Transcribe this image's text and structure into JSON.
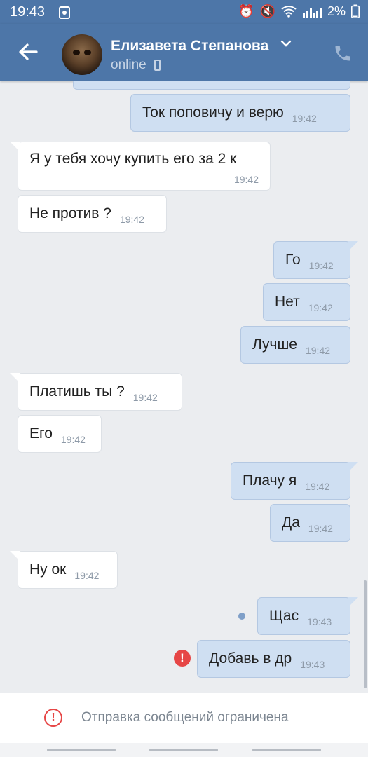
{
  "status_bar": {
    "time": "19:43",
    "battery": "2%",
    "icons": [
      "notification-icon",
      "alarm-icon",
      "mute-icon",
      "wifi-icon",
      "signal-icon",
      "battery-icon"
    ]
  },
  "header": {
    "contact_name": "Елизавета Степанова",
    "status": "online",
    "icons": [
      "back-arrow-icon",
      "avatar",
      "chevron-down-icon",
      "mobile-icon",
      "phone-icon"
    ]
  },
  "messages": [
    {
      "direction": "out",
      "text": "Ток поповичу и верю",
      "time": "19:42"
    },
    {
      "direction": "in",
      "text": "Я у тебя хочу купить его за 2 к",
      "time": "19:42"
    },
    {
      "direction": "in",
      "text": "Не против ?",
      "time": "19:42"
    },
    {
      "direction": "out",
      "text": "Го",
      "time": "19:42"
    },
    {
      "direction": "out",
      "text": "Нет",
      "time": "19:42"
    },
    {
      "direction": "out",
      "text": "Лучше",
      "time": "19:42"
    },
    {
      "direction": "in",
      "text": "Платишь ты ?",
      "time": "19:42"
    },
    {
      "direction": "in",
      "text": "Его",
      "time": "19:42"
    },
    {
      "direction": "out",
      "text": "Плачу я",
      "time": "19:42"
    },
    {
      "direction": "out",
      "text": "Да",
      "time": "19:42"
    },
    {
      "direction": "in",
      "text": "Ну ок",
      "time": "19:42"
    },
    {
      "direction": "out",
      "text": "Щас",
      "time": "19:43",
      "state": "sending"
    },
    {
      "direction": "out",
      "text": "Добавь в др",
      "time": "19:43",
      "state": "error"
    }
  ],
  "footer": {
    "restriction_text": "Отправка сообщений ограничена"
  },
  "colors": {
    "header": "#4d76a8",
    "outgoing_bubble": "#cfdff2",
    "incoming_bubble": "#ffffff",
    "background": "#ebedf0",
    "error": "#e64646"
  }
}
